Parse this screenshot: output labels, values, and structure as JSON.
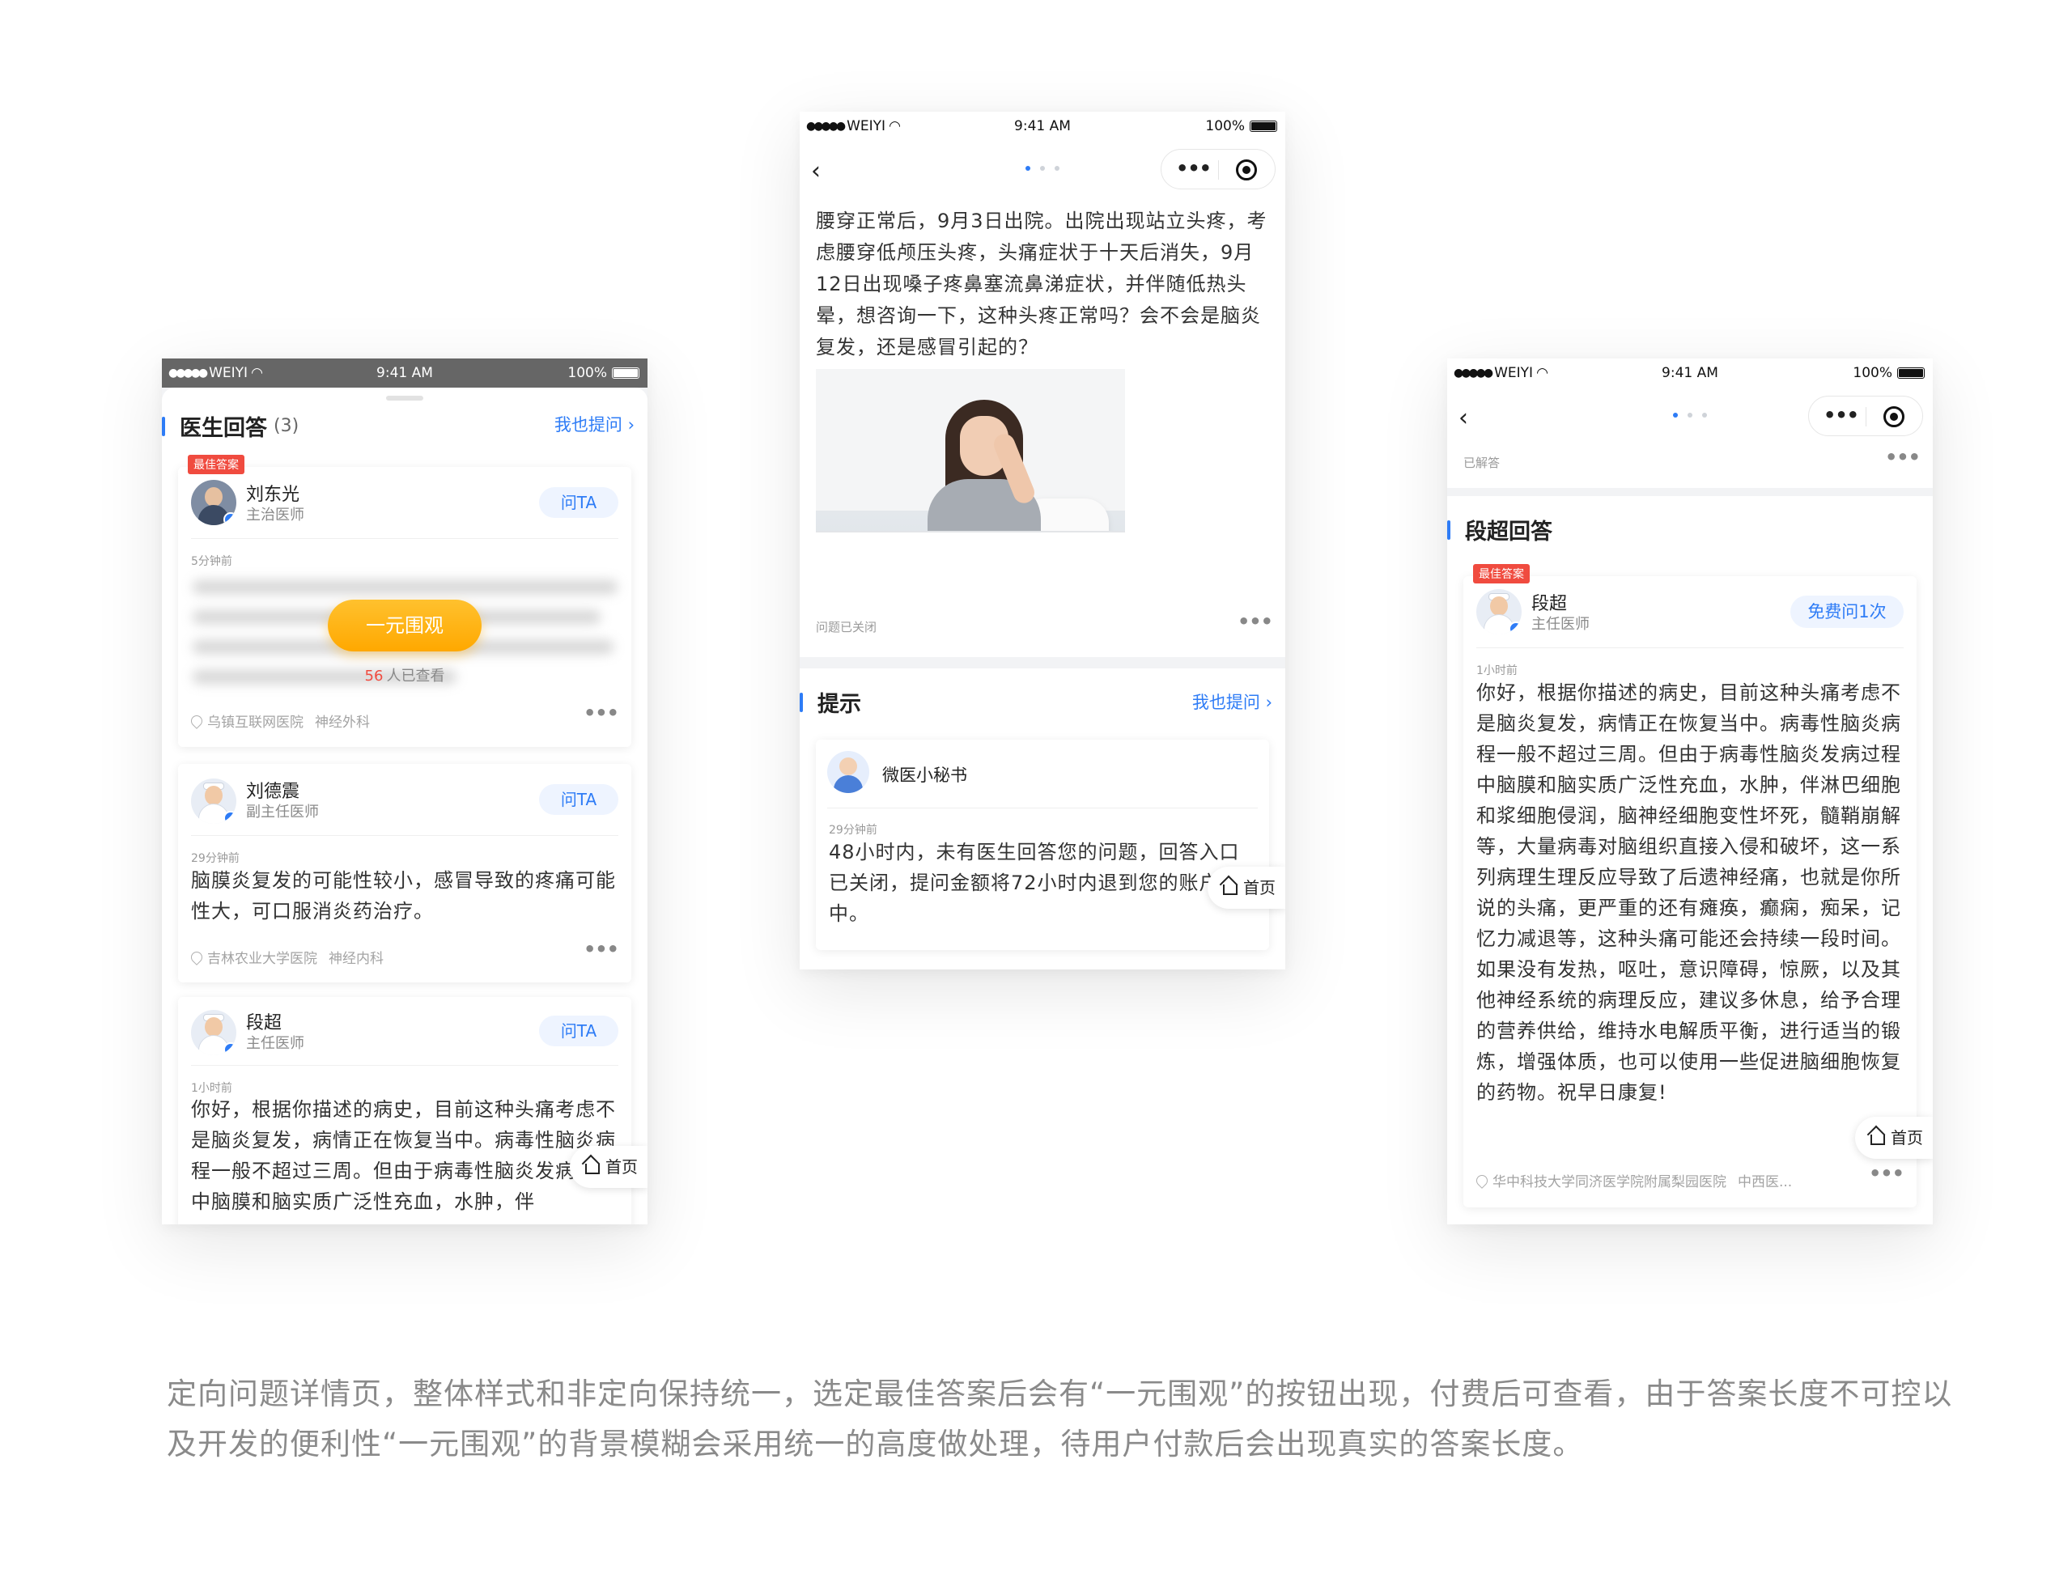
{
  "statusbar": {
    "carrier": "WEIYI",
    "time": "9:41 AM",
    "battery": "100%"
  },
  "phone1": {
    "section_title": "医生回答",
    "count": "(3)",
    "ask_link": "我也提问",
    "answers": [
      {
        "badge": "最佳答案",
        "name": "刘东光",
        "title": "主治医师",
        "ask_label": "问TA",
        "time": "5分钟前",
        "pay_button": "一元围观",
        "viewers_count": "56",
        "viewers_text": "人已查看",
        "hospital": "乌镇互联网医院",
        "department": "神经外科"
      },
      {
        "name": "刘德震",
        "title": "副主任医师",
        "ask_label": "问TA",
        "time": "29分钟前",
        "text": "脑膜炎复发的可能性较小，感冒导致的疼痛可能性大，可口服消炎药治疗。",
        "hospital": "吉林农业大学医院",
        "department": "神经内科"
      },
      {
        "name": "段超",
        "title": "主任医师",
        "ask_label": "问TA",
        "time": "1小时前",
        "text": "你好，根据你描述的病史，目前这种头痛考虑不是脑炎复发，病情正在恢复当中。病毒性脑炎病程一般不超过三周。但由于病毒性脑炎发病过程中脑膜和脑实质广泛性充血，水肿，伴"
      }
    ],
    "home_label": "首页"
  },
  "phone2": {
    "question_text": "腰穿正常后，9月3日出院。出院出现站立头疼，考虑腰穿低颅压头疼，头痛症状于十天后消失，9月12日出现嗓子疼鼻塞流鼻涕症状，并伴随低热头晕，想咨询一下，这种头疼正常吗？会不会是脑炎复发，还是感冒引起的？",
    "closed_label": "问题已关闭",
    "section_title": "提示",
    "ask_link": "我也提问",
    "secretary_name": "微医小秘书",
    "secretary_time": "29分钟前",
    "secretary_text": "48小时内，未有医生回答您的问题，回答入口已关闭，提问金额将72小时内退到您的账户中。",
    "home_label": "首页"
  },
  "phone3": {
    "solved_label": "已解答",
    "section_title": "段超回答",
    "badge": "最佳答案",
    "name": "段超",
    "title": "主任医师",
    "free_button": "免费问1次",
    "time": "1小时前",
    "text": "你好，根据你描述的病史，目前这种头痛考虑不是脑炎复发，病情正在恢复当中。病毒性脑炎病程一般不超过三周。但由于病毒性脑炎发病过程中脑膜和脑实质广泛性充血，水肿，伴淋巴细胞和浆细胞侵润，脑神经细胞变性坏死，髓鞘崩解等，大量病毒对脑组织直接入侵和破坏，这一系列病理生理反应导致了后遗神经痛，也就是你所说的头痛，更严重的还有瘫痪，癫痫，痴呆，记忆力减退等，这种头痛可能还会持续一段时间。如果没有发热，呕吐，意识障碍，惊厥，以及其他神经系统的病理反应，建议多休息，给予合理的营养供给，维持水电解质平衡，进行适当的锻炼，增强体质，也可以使用一些促进脑细胞恢复的药物。祝早日康复!",
    "hospital": "华中科技大学同济医学院附属梨园医院",
    "department": "中西医...",
    "home_label": "首页"
  },
  "caption": "定向问题详情页，整体样式和非定向保持统一，选定最佳答案后会有“一元围观”的按钮出现，付费后可查看，由于答案长度不可控以及开发的便利性“一元围观”的背景模糊会采用统一的高度做处理，待用户付款后会出现真实的答案长度。",
  "colors": {
    "accent": "#2e7cf6",
    "best_tag": "#f04b3f",
    "pay_button": "#ffb000",
    "caption": "#8a8a8a"
  },
  "icons": [
    "back-icon",
    "more-icon",
    "close-circle-icon",
    "location-icon",
    "home-icon",
    "verified-icon",
    "signal-icon",
    "wifi-icon",
    "battery-icon"
  ]
}
